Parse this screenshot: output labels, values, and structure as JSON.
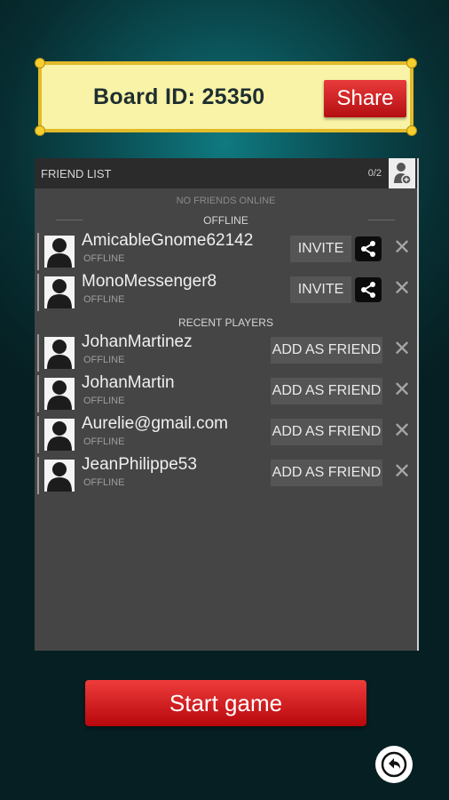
{
  "board": {
    "id_label": "Board ID: 25350",
    "share_label": "Share"
  },
  "friend_list": {
    "title": "FRIEND LIST",
    "count": "0/2",
    "no_friends_online": "NO FRIENDS ONLINE",
    "offline_heading": "OFFLINE",
    "recent_heading": "RECENT PLAYERS",
    "offline": [
      {
        "name": "AmicableGnome62142",
        "status": "OFFLINE",
        "action": "INVITE"
      },
      {
        "name": "MonoMessenger8",
        "status": "OFFLINE",
        "action": "INVITE"
      }
    ],
    "recent": [
      {
        "name": "JohanMartinez",
        "status": "OFFLINE",
        "action": "ADD AS FRIEND"
      },
      {
        "name": "JohanMartin",
        "status": "OFFLINE",
        "action": "ADD AS FRIEND"
      },
      {
        "name": "Aurelie@gmail.com",
        "status": "OFFLINE",
        "action": "ADD AS FRIEND"
      },
      {
        "name": "JeanPhilippe53",
        "status": "OFFLINE",
        "action": "ADD AS FRIEND"
      }
    ]
  },
  "start_button": "Start game",
  "colors": {
    "accent_red": "#d01d1f",
    "panel_yellow": "#f8f3a6",
    "panel_gold": "#e2bb2a",
    "list_bg": "#454545"
  },
  "icons": [
    "share-icon",
    "close-icon",
    "avatar-icon",
    "add-friend-icon",
    "back-icon"
  ]
}
